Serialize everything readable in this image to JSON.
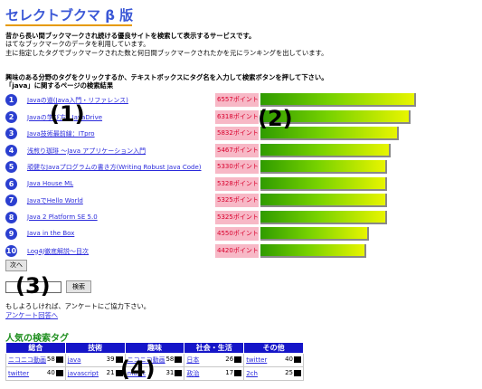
{
  "app": {
    "title": "セレクトブクマ β 版"
  },
  "intro": {
    "line1": "昔から長い間ブックマークされ続ける優良サイトを検索して表示するサービスです。",
    "line2": "はてなブックマークのデータを利用しています。",
    "line3": "主に指定したタグでブックマークされた数と何日間ブックマークされたかを元にランキングを出しています。"
  },
  "instructions": {
    "line1": "興味のある分野のタグをクリックするか、テキストボックスにタグ名を入力して検索ボタンを押して下さい。",
    "line2": "「java」に関するページの検索結果"
  },
  "results": [
    {
      "rank": "1",
      "title": "Javaの道(Java入門・リファレンス)",
      "points": "6557ポイント",
      "value": 6557
    },
    {
      "rank": "2",
      "title": "Javaの学び方 | JavaDrive",
      "points": "6318ポイント",
      "value": 6318
    },
    {
      "rank": "3",
      "title": "Java技術最前線：ITpro",
      "points": "5832ポイント",
      "value": 5832
    },
    {
      "rank": "4",
      "title": "浅煎り珈琲 ～Java アプリケーション入門",
      "points": "5467ポイント",
      "value": 5467
    },
    {
      "rank": "5",
      "title": "頑健なJavaプログラムの書き方(Writing Robust Java Code)",
      "points": "5330ポイント",
      "value": 5330
    },
    {
      "rank": "6",
      "title": "Java House ML",
      "points": "5328ポイント",
      "value": 5328
    },
    {
      "rank": "7",
      "title": "JavaでHello World",
      "points": "5325ポイント",
      "value": 5325
    },
    {
      "rank": "8",
      "title": "Java 2 Platform SE 5.0",
      "points": "5325ポイント",
      "value": 5325
    },
    {
      "rank": "9",
      "title": "Java in the Box",
      "points": "4550ポイント",
      "value": 4550
    },
    {
      "rank": "10",
      "title": "Log4J徹底解説～目次",
      "points": "4420ポイント",
      "value": 4420
    }
  ],
  "next_label": "次へ",
  "search": {
    "value": "",
    "button": "検索"
  },
  "survey": {
    "text": "もしよろしければ、アンケートにご協力下さい。",
    "link": "アンケート回答へ"
  },
  "tags": {
    "title": "人気の検索タグ",
    "headers": [
      "総合",
      "技術",
      "趣味",
      "社会・生活",
      "その他"
    ],
    "rows": [
      [
        {
          "tag": "ニコニコ動画",
          "count": "58"
        },
        {
          "tag": "java",
          "count": "39"
        },
        {
          "tag": "ニコニコ動画",
          "count": "58"
        },
        {
          "tag": "日本",
          "count": "26"
        },
        {
          "tag": "twitter",
          "count": "40"
        }
      ],
      [
        {
          "tag": "twitter",
          "count": "40"
        },
        {
          "tag": "javascript",
          "count": "21"
        },
        {
          "tag": "music",
          "count": "31"
        },
        {
          "tag": "政治",
          "count": "17"
        },
        {
          "tag": "2ch",
          "count": "25"
        }
      ]
    ]
  },
  "callouts": [
    "(1)",
    "(2)",
    "(3)",
    "(4)"
  ]
}
